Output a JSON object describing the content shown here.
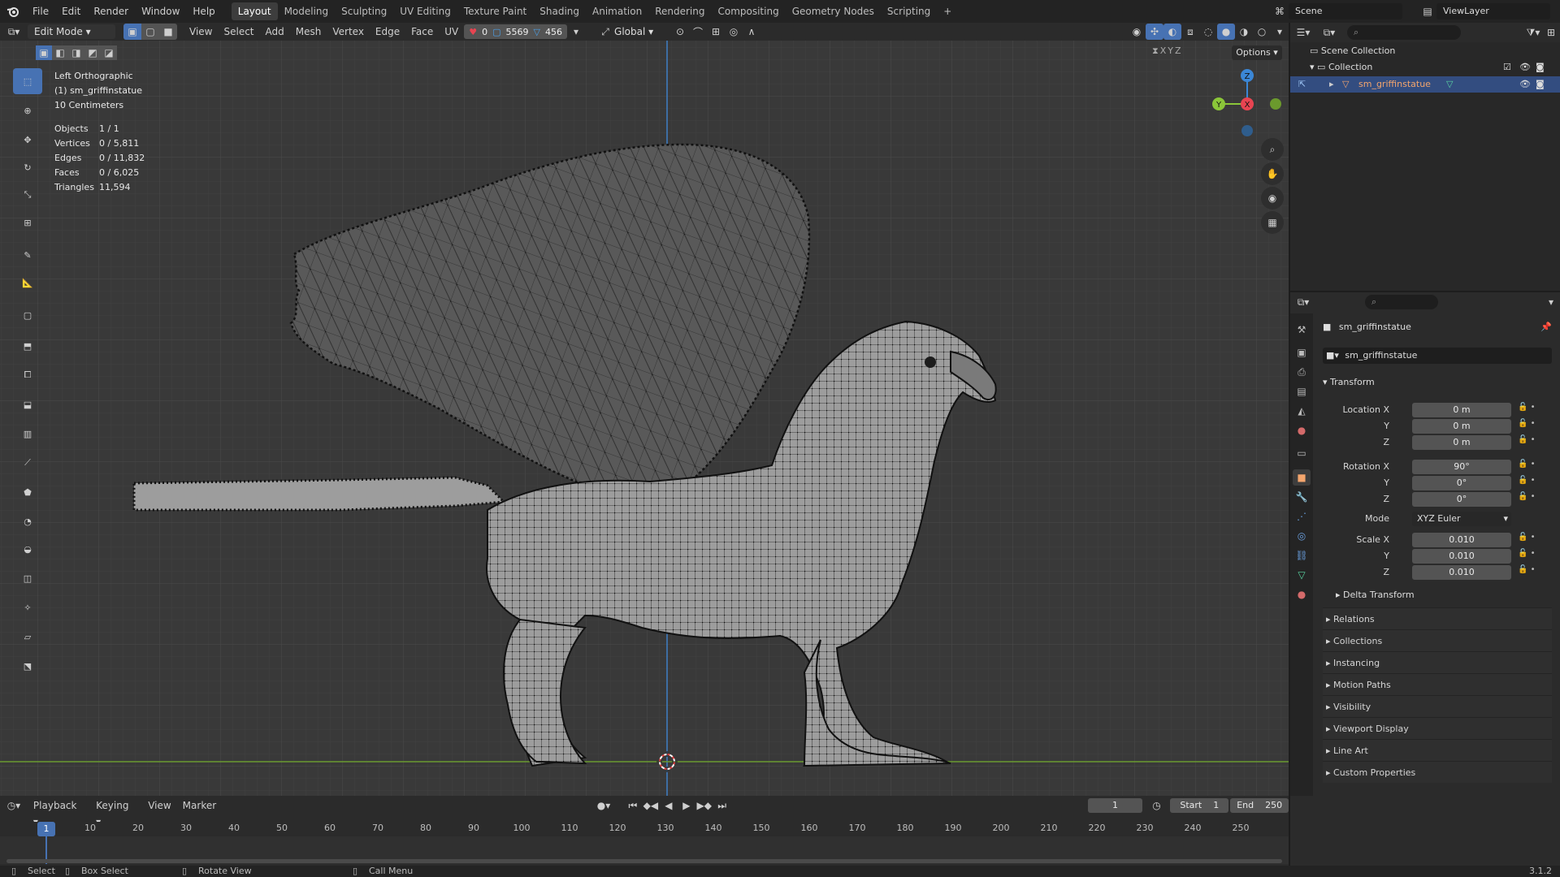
{
  "menu": [
    "File",
    "Edit",
    "Render",
    "Window",
    "Help"
  ],
  "workspaces": [
    "Layout",
    "Modeling",
    "Sculpting",
    "UV Editing",
    "Texture Paint",
    "Shading",
    "Animation",
    "Rendering",
    "Compositing",
    "Geometry Nodes",
    "Scripting"
  ],
  "active_workspace": "Layout",
  "scene_name": "Scene",
  "view_layer": "ViewLayer",
  "viewport_header": {
    "mode": "Edit Mode",
    "menus": [
      "View",
      "Select",
      "Add",
      "Mesh",
      "Vertex",
      "Edge",
      "Face",
      "UV"
    ],
    "uv_counts": {
      "a": "0",
      "b": "5569",
      "c": "456"
    },
    "orientation": "Global",
    "options": "Options"
  },
  "viewport_overlay": {
    "view_name": "Left Orthographic",
    "object_label": "(1) sm_griffinstatue",
    "scale_label": "10 Centimeters",
    "stats": [
      {
        "label": "Objects",
        "value": "1 / 1"
      },
      {
        "label": "Vertices",
        "value": "0 / 5,811"
      },
      {
        "label": "Edges",
        "value": "0 / 11,832"
      },
      {
        "label": "Faces",
        "value": "0 / 6,025"
      },
      {
        "label": "Triangles",
        "value": "11,594"
      }
    ]
  },
  "outliner": {
    "root": "Scene Collection",
    "collection": "Collection",
    "object": "sm_griffinstatue"
  },
  "properties": {
    "object_name": "sm_griffinstatue",
    "datablock": "sm_griffinstatue",
    "transform_title": "Transform",
    "location": {
      "label": "Location X",
      "x": "0 m",
      "y": "0 m",
      "z": "0 m"
    },
    "rotation": {
      "label": "Rotation X",
      "x": "90°",
      "y": "0°",
      "z": "0°"
    },
    "mode_label": "Mode",
    "mode_value": "XYZ Euler",
    "scale": {
      "label": "Scale X",
      "x": "0.010",
      "y": "0.010",
      "z": "0.010"
    },
    "axis_labels": {
      "y": "Y",
      "z": "Z"
    },
    "delta": "Delta Transform",
    "panels": [
      "Relations",
      "Collections",
      "Instancing",
      "Motion Paths",
      "Visibility",
      "Viewport Display",
      "Line Art",
      "Custom Properties"
    ]
  },
  "timeline": {
    "menus": [
      "Playback",
      "Keying",
      "View",
      "Marker"
    ],
    "current_frame": "1",
    "start_label": "Start",
    "start": "1",
    "end_label": "End",
    "end": "250",
    "ticks": [
      "10",
      "20",
      "30",
      "40",
      "50",
      "60",
      "70",
      "80",
      "90",
      "100",
      "110",
      "120",
      "130",
      "140",
      "150",
      "160",
      "170",
      "180",
      "190",
      "200",
      "210",
      "220",
      "230",
      "240",
      "250"
    ],
    "marker_frame": "1"
  },
  "statusbar": {
    "items": [
      "Select",
      "Box Select",
      "Rotate View",
      "Call Menu"
    ],
    "version": "3.1.2"
  },
  "gizmo": {
    "x": "X",
    "y": "Y",
    "z": "Z"
  },
  "colors": {
    "accent": "#4772b3",
    "x_axis": "#e84451",
    "y_axis": "#8bc639",
    "z_axis": "#3b87d6"
  }
}
